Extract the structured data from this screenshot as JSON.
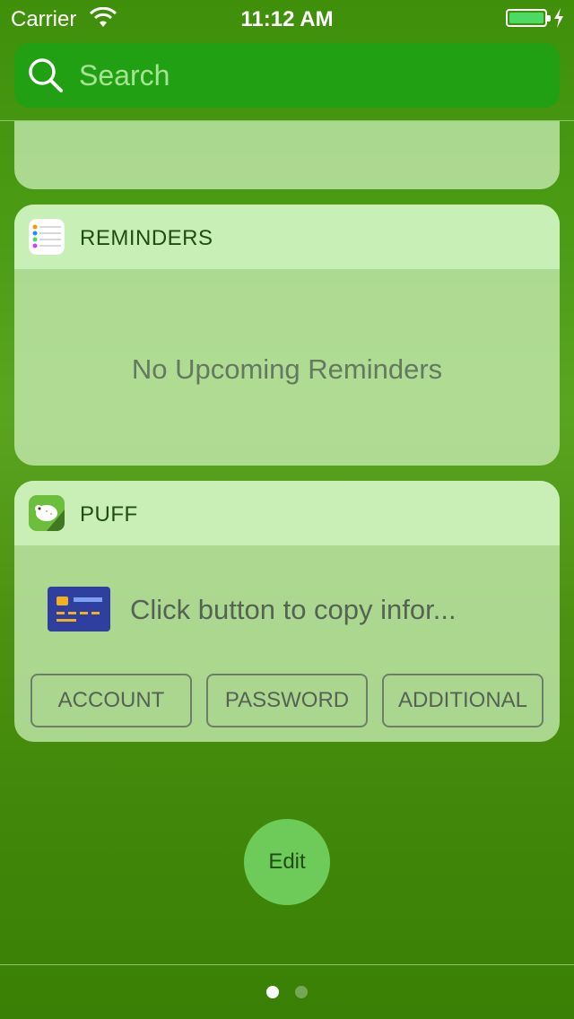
{
  "status_bar": {
    "carrier": "Carrier",
    "time": "11:12 AM",
    "battery_color": "#4cd964"
  },
  "search": {
    "placeholder": "Search",
    "icon": "search-icon"
  },
  "widgets": {
    "reminders": {
      "title": "REMINDERS",
      "icon": "reminders-app-icon",
      "empty_message": "No Upcoming Reminders"
    },
    "puff": {
      "title": "PUFF",
      "icon": "puff-app-icon",
      "card_icon": "credit-card-icon",
      "message": "Click button to copy infor...",
      "buttons": [
        "ACCOUNT",
        "PASSWORD",
        "ADDITIONAL"
      ]
    }
  },
  "edit_label": "Edit",
  "page_indicator": {
    "pages": 2,
    "current": 1
  },
  "colors": {
    "search_bg": "#20a012",
    "edit_bg": "#6ecb5a",
    "title_color": "#1f4d12"
  }
}
